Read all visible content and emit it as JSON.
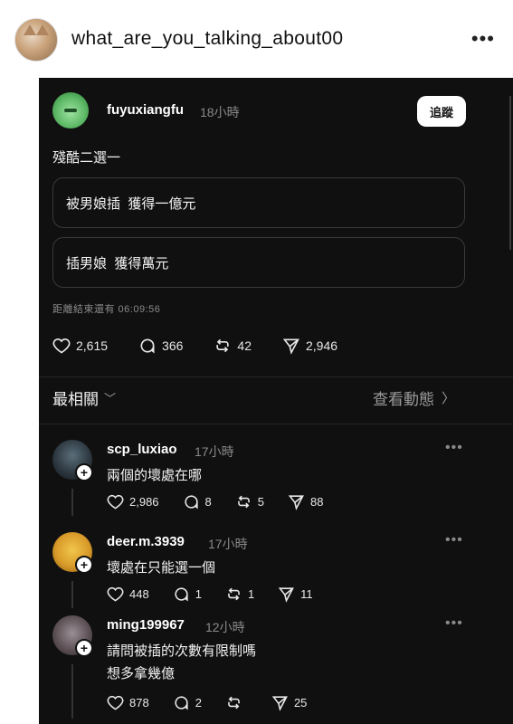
{
  "header": {
    "username": "what_are_you_talking_about00",
    "more_icon": "more-horizontal-icon"
  },
  "post": {
    "username": "fuyuxiangfu",
    "time": "18小時",
    "follow_label": "追蹤",
    "text": "殘酷二選一",
    "poll_options": [
      "被男娘插  獲得一億元",
      "插男娘  獲得萬元"
    ],
    "poll_remaining": "距離結束還有 06:09:56",
    "stats": {
      "likes": "2,615",
      "comments": "366",
      "reposts": "42",
      "shares": "2,946"
    }
  },
  "sort": {
    "label": "最相關",
    "view_activity": "查看動態"
  },
  "replies": [
    {
      "username": "scp_luxiao",
      "time": "17小時",
      "lines": [
        "兩個的壞處在哪"
      ],
      "stats": {
        "likes": "2,986",
        "comments": "8",
        "reposts": "5",
        "shares": "88"
      }
    },
    {
      "username": "deer.m.3939",
      "time": "17小時",
      "lines": [
        "壞處在只能選一個"
      ],
      "stats": {
        "likes": "448",
        "comments": "1",
        "reposts": "1",
        "shares": "11"
      }
    },
    {
      "username": "ming199967",
      "time": "12小時",
      "lines": [
        "請問被插的次數有限制嗎",
        "想多拿幾億"
      ],
      "stats": {
        "likes": "878",
        "comments": "2",
        "reposts": "",
        "shares": "25"
      }
    }
  ],
  "colors": {
    "background": "#101010",
    "text": "#f3f3f3",
    "muted": "#8a8a8a",
    "border": "#3a3a3a"
  }
}
